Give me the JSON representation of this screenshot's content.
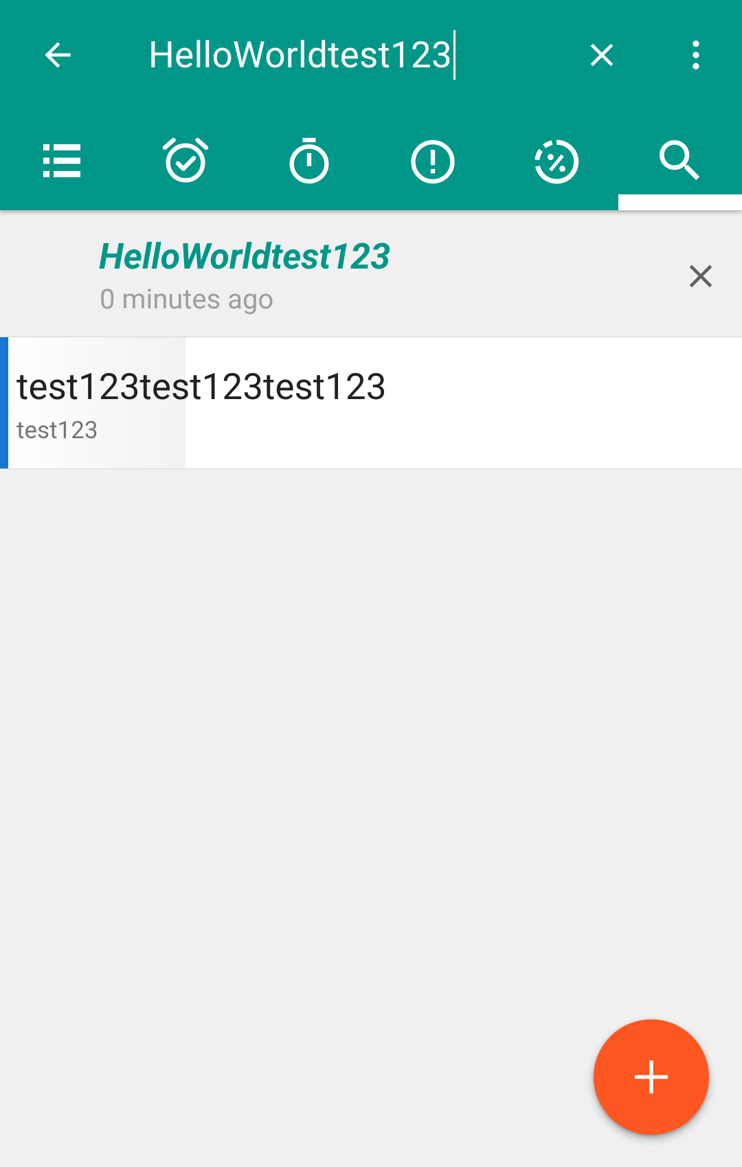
{
  "toolbar": {
    "search_query": "HelloWorldtest123",
    "icons": {
      "back": "arrow-back-icon",
      "clear": "close-icon",
      "more": "more-vert-icon"
    }
  },
  "tabs": [
    {
      "icon": "list-icon",
      "selected": false
    },
    {
      "icon": "alarm-check-icon",
      "selected": false
    },
    {
      "icon": "timer-icon",
      "selected": false
    },
    {
      "icon": "alert-circle-icon",
      "selected": false
    },
    {
      "icon": "progress-percent-icon",
      "selected": false
    },
    {
      "icon": "search-icon",
      "selected": true
    }
  ],
  "group": {
    "title": "HelloWorldtest123",
    "subtitle": "0 minutes ago"
  },
  "tasks": [
    {
      "title": "test123test123test123",
      "note": "test123",
      "accent_color": "#1976d2"
    }
  ],
  "fab": {
    "icon": "plus-icon"
  },
  "colors": {
    "primary": "#009688",
    "accent": "#ff5722",
    "background": "#f0f0f0"
  }
}
